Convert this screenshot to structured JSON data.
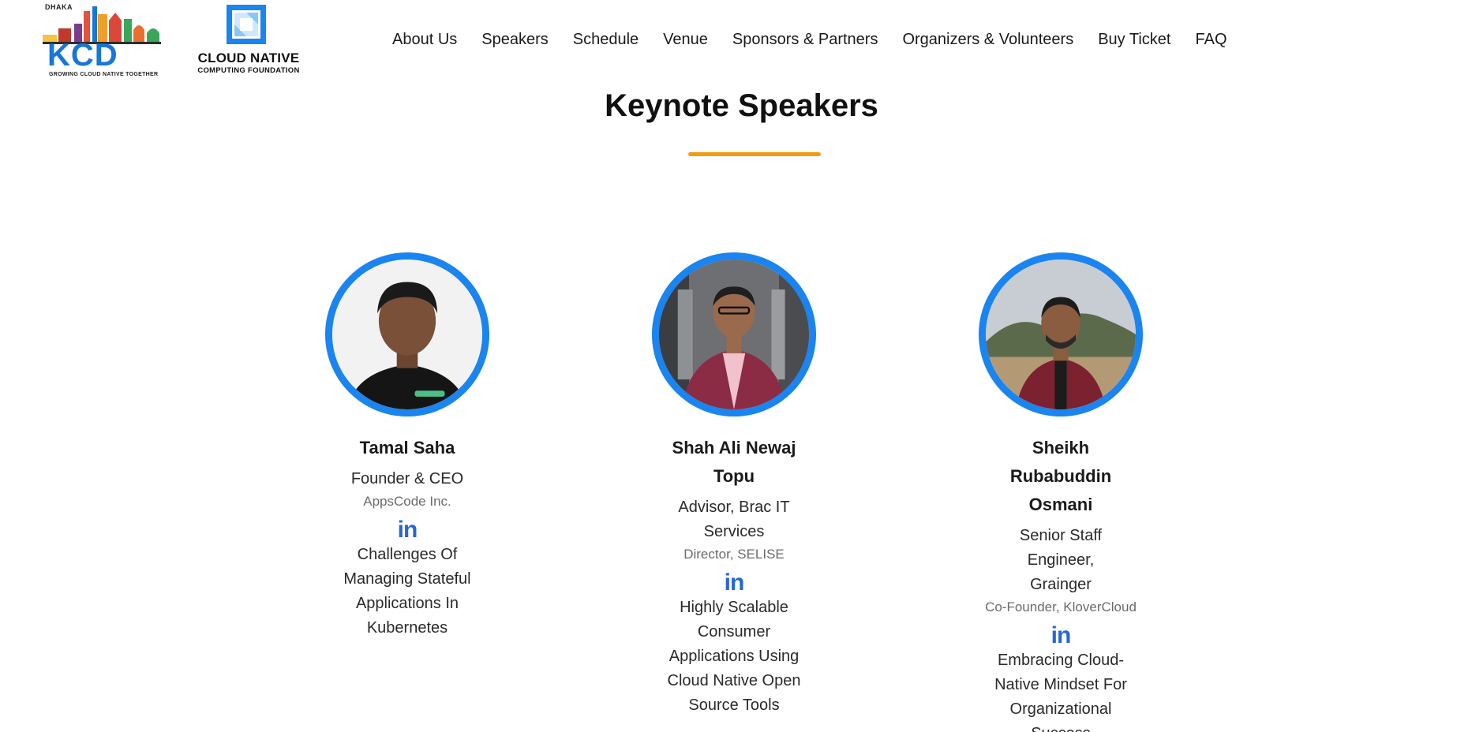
{
  "header": {
    "kcd_logo": {
      "city": "DHAKA",
      "wordmark": "KCD",
      "tagline": "GROWING CLOUD NATIVE TOGETHER"
    },
    "cncf_logo": {
      "line1": "CLOUD NATIVE",
      "line2": "COMPUTING FOUNDATION"
    },
    "nav": [
      {
        "label": "About Us"
      },
      {
        "label": "Speakers"
      },
      {
        "label": "Schedule"
      },
      {
        "label": "Venue"
      },
      {
        "label": "Sponsors & Partners"
      },
      {
        "label": "Organizers & Volunteers"
      },
      {
        "label": "Buy Ticket"
      },
      {
        "label": "FAQ"
      }
    ]
  },
  "section": {
    "title": "Keynote Speakers",
    "accent_color": "#f39c12"
  },
  "speakers": [
    {
      "name": "Tamal Saha",
      "role": "Founder & CEO",
      "org": "AppsCode Inc.",
      "linkedin": "in",
      "talk": "Challenges Of Managing Stateful Applications In Kubernetes"
    },
    {
      "name": "Shah Ali Newaj Topu",
      "role": "Advisor, Brac IT Services",
      "org": "Director, SELISE",
      "linkedin": "in",
      "talk": "Highly Scalable Consumer Applications Using Cloud Native Open Source Tools"
    },
    {
      "name": "Sheikh Rubabuddin Osmani",
      "role": "Senior Staff Engineer, Grainger",
      "org": "Co-Founder, KloverCloud",
      "linkedin": "in",
      "talk": "Embracing Cloud-Native Mindset For Organizational Success"
    }
  ],
  "colors": {
    "avatar_ring": "#1a84f0",
    "linkedin": "#2667d6",
    "kcd_blue": "#1677d8"
  },
  "icons": {
    "linkedin": "linkedin-icon",
    "cncf": "cncf-logo-icon"
  }
}
